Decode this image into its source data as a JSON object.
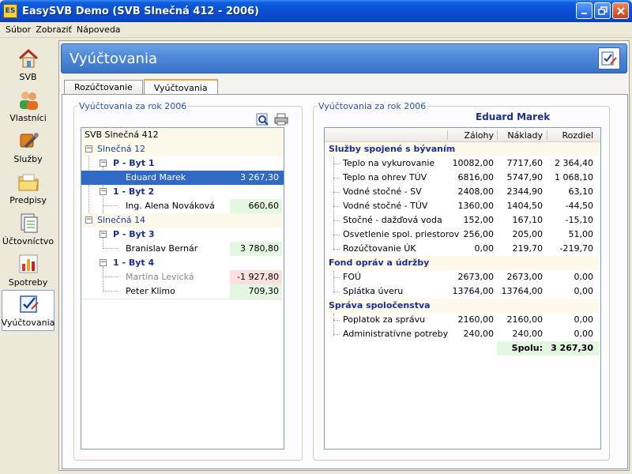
{
  "window": {
    "app_icon_text": "ES",
    "title": "EasySVB Demo  (SVB Slnečná 412 - 2006)"
  },
  "menu": [
    "Súbor",
    "Zobraziť",
    "Nápoveda"
  ],
  "nav": [
    {
      "label": "SVB",
      "icon": "house-icon"
    },
    {
      "label": "Vlastníci",
      "icon": "owners-icon"
    },
    {
      "label": "Služby",
      "icon": "tools-icon"
    },
    {
      "label": "Predpisy",
      "icon": "folder-icon"
    },
    {
      "label": "Účtovníctvo",
      "icon": "ledger-icon"
    },
    {
      "label": "Spotreby",
      "icon": "bar-chart-icon"
    },
    {
      "label": "Vyúčtovania",
      "icon": "checklist-icon",
      "active": true
    }
  ],
  "header": {
    "title": "Vyúčtovania"
  },
  "tabs": [
    "Rozúčtovanie",
    "Vyúčtovania"
  ],
  "left_panel": {
    "group_title": "Vyúčtovania za rok 2006",
    "tree": {
      "root": "SVB Slnečná 412",
      "building1": "Slnečná 12",
      "b1_flat1": "P - Byt 1",
      "b1_flat1_owner": "Eduard Marek",
      "b1_flat1_value": "3 267,30",
      "b1_flat2": "1 - Byt 2",
      "b1_flat2_owner": "Ing. Alena Nováková",
      "b1_flat2_value": "660,60",
      "building2": "Slnečná 14",
      "b2_flat3": "P - Byt 3",
      "b2_flat3_owner": "Branislav Bernár",
      "b2_flat3_value": "3 780,80",
      "b2_flat4": "1 - Byt 4",
      "b2_flat4_owner1": "Martina Levická",
      "b2_flat4_value1": "-1 927,80",
      "b2_flat4_owner2": "Peter Klimo",
      "b2_flat4_value2": "709,30"
    }
  },
  "right_panel": {
    "group_title": "Vyúčtovania za rok 2006",
    "person": "Eduard Marek",
    "columns": [
      "Zálohy",
      "Náklady",
      "Rozdiel"
    ],
    "sections": {
      "s1": "Služby spojené s bývaním",
      "s2": "Fond opráv a údržby",
      "s3": "Správa spoločenstva"
    },
    "rows": [
      {
        "name": "Teplo na vykurovanie",
        "a": "10082,00",
        "b": "7717,60",
        "c": "2 364,40"
      },
      {
        "name": "Teplo na ohrev TÚV",
        "a": "6816,00",
        "b": "5747,90",
        "c": "1 068,10"
      },
      {
        "name": "Vodné stočné - SV",
        "a": "2408,00",
        "b": "2344,90",
        "c": "63,10"
      },
      {
        "name": "Vodné stočné - TÚV",
        "a": "1360,00",
        "b": "1404,50",
        "c": "-44,50"
      },
      {
        "name": "Stočné - dažďová voda",
        "a": "152,00",
        "b": "167,10",
        "c": "-15,10"
      },
      {
        "name": "Osvetlenie spol. priestorov",
        "a": "256,00",
        "b": "205,00",
        "c": "51,00"
      },
      {
        "name": "Rozúčtovanie ÚK",
        "a": "0,00",
        "b": "219,70",
        "c": "-219,70"
      },
      {
        "name": "FOÚ",
        "a": "2673,00",
        "b": "2673,00",
        "c": "0,00"
      },
      {
        "name": "Splátka úveru",
        "a": "13764,00",
        "b": "13764,00",
        "c": "0,00"
      },
      {
        "name": "Poplatok za správu",
        "a": "2160,00",
        "b": "2160,00",
        "c": "0,00"
      },
      {
        "name": "Administratívne potreby",
        "a": "240,00",
        "b": "240,00",
        "c": "0,00"
      }
    ],
    "total_label": "Spolu:",
    "total_value": "3 267,30"
  }
}
